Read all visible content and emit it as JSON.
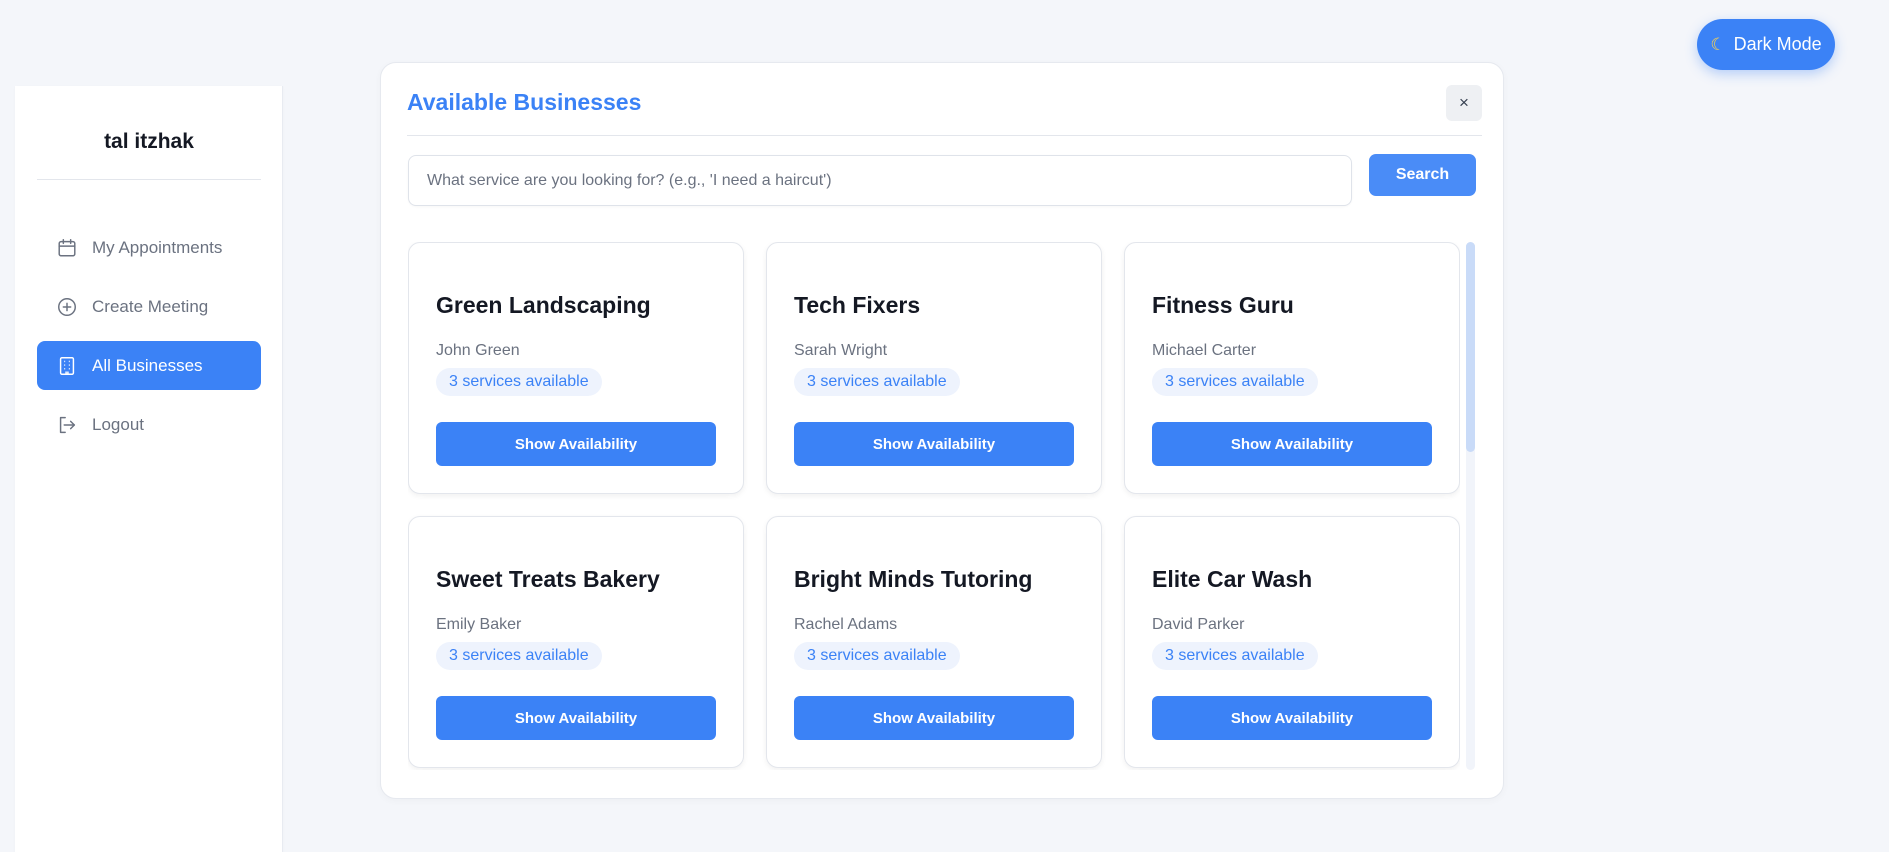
{
  "theme_toggle": {
    "label": "Dark Mode",
    "icon": "moon-icon"
  },
  "sidebar": {
    "user_name": "tal itzhak",
    "items": [
      {
        "label": "My Appointments",
        "icon": "calendar-icon",
        "active": false
      },
      {
        "label": "Create Meeting",
        "icon": "plus-circle-icon",
        "active": false
      },
      {
        "label": "All Businesses",
        "icon": "building-icon",
        "active": true
      },
      {
        "label": "Logout",
        "icon": "logout-icon",
        "active": false
      }
    ]
  },
  "modal": {
    "title": "Available Businesses",
    "close_label": "×",
    "search": {
      "placeholder": "What service are you looking for? (e.g., 'I need a haircut')",
      "value": "",
      "button_label": "Search"
    },
    "businesses": [
      {
        "name": "Green Landscaping",
        "owner": "John Green",
        "services": "3 services available",
        "button": "Show Availability"
      },
      {
        "name": "Tech Fixers",
        "owner": "Sarah Wright",
        "services": "3 services available",
        "button": "Show Availability"
      },
      {
        "name": "Fitness Guru",
        "owner": "Michael Carter",
        "services": "3 services available",
        "button": "Show Availability"
      },
      {
        "name": "Sweet Treats Bakery",
        "owner": "Emily Baker",
        "services": "3 services available",
        "button": "Show Availability"
      },
      {
        "name": "Bright Minds Tutoring",
        "owner": "Rachel Adams",
        "services": "3 services available",
        "button": "Show Availability"
      },
      {
        "name": "Elite Car Wash",
        "owner": "David Parker",
        "services": "3 services available",
        "button": "Show Availability"
      }
    ]
  },
  "colors": {
    "accent": "#3b82f6",
    "background": "#f4f6fa",
    "badge_bg": "#eef3fd",
    "muted_text": "#6b7280"
  }
}
